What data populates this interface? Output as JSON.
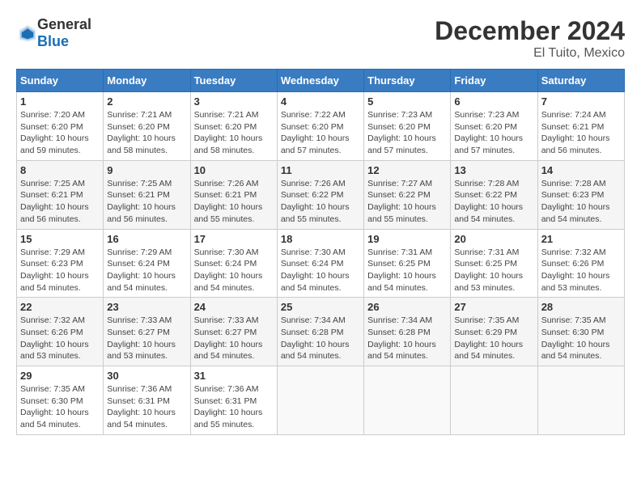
{
  "logo": {
    "general": "General",
    "blue": "Blue"
  },
  "header": {
    "title": "December 2024",
    "subtitle": "El Tuito, Mexico"
  },
  "calendar": {
    "columns": [
      "Sunday",
      "Monday",
      "Tuesday",
      "Wednesday",
      "Thursday",
      "Friday",
      "Saturday"
    ],
    "weeks": [
      [
        {
          "day": "",
          "info": ""
        },
        {
          "day": "",
          "info": ""
        },
        {
          "day": "",
          "info": ""
        },
        {
          "day": "",
          "info": ""
        },
        {
          "day": "5",
          "info": "Sunrise: 7:23 AM\nSunset: 6:20 PM\nDaylight: 10 hours\nand 57 minutes."
        },
        {
          "day": "6",
          "info": "Sunrise: 7:23 AM\nSunset: 6:20 PM\nDaylight: 10 hours\nand 57 minutes."
        },
        {
          "day": "7",
          "info": "Sunrise: 7:24 AM\nSunset: 6:21 PM\nDaylight: 10 hours\nand 56 minutes."
        }
      ],
      [
        {
          "day": "1",
          "info": "Sunrise: 7:20 AM\nSunset: 6:20 PM\nDaylight: 10 hours\nand 59 minutes."
        },
        {
          "day": "2",
          "info": "Sunrise: 7:21 AM\nSunset: 6:20 PM\nDaylight: 10 hours\nand 58 minutes."
        },
        {
          "day": "3",
          "info": "Sunrise: 7:21 AM\nSunset: 6:20 PM\nDaylight: 10 hours\nand 58 minutes."
        },
        {
          "day": "4",
          "info": "Sunrise: 7:22 AM\nSunset: 6:20 PM\nDaylight: 10 hours\nand 57 minutes."
        },
        {
          "day": "5",
          "info": "Sunrise: 7:23 AM\nSunset: 6:20 PM\nDaylight: 10 hours\nand 57 minutes."
        },
        {
          "day": "6",
          "info": "Sunrise: 7:23 AM\nSunset: 6:20 PM\nDaylight: 10 hours\nand 57 minutes."
        },
        {
          "day": "7",
          "info": "Sunrise: 7:24 AM\nSunset: 6:21 PM\nDaylight: 10 hours\nand 56 minutes."
        }
      ],
      [
        {
          "day": "8",
          "info": "Sunrise: 7:25 AM\nSunset: 6:21 PM\nDaylight: 10 hours\nand 56 minutes."
        },
        {
          "day": "9",
          "info": "Sunrise: 7:25 AM\nSunset: 6:21 PM\nDaylight: 10 hours\nand 56 minutes."
        },
        {
          "day": "10",
          "info": "Sunrise: 7:26 AM\nSunset: 6:21 PM\nDaylight: 10 hours\nand 55 minutes."
        },
        {
          "day": "11",
          "info": "Sunrise: 7:26 AM\nSunset: 6:22 PM\nDaylight: 10 hours\nand 55 minutes."
        },
        {
          "day": "12",
          "info": "Sunrise: 7:27 AM\nSunset: 6:22 PM\nDaylight: 10 hours\nand 55 minutes."
        },
        {
          "day": "13",
          "info": "Sunrise: 7:28 AM\nSunset: 6:22 PM\nDaylight: 10 hours\nand 54 minutes."
        },
        {
          "day": "14",
          "info": "Sunrise: 7:28 AM\nSunset: 6:23 PM\nDaylight: 10 hours\nand 54 minutes."
        }
      ],
      [
        {
          "day": "15",
          "info": "Sunrise: 7:29 AM\nSunset: 6:23 PM\nDaylight: 10 hours\nand 54 minutes."
        },
        {
          "day": "16",
          "info": "Sunrise: 7:29 AM\nSunset: 6:24 PM\nDaylight: 10 hours\nand 54 minutes."
        },
        {
          "day": "17",
          "info": "Sunrise: 7:30 AM\nSunset: 6:24 PM\nDaylight: 10 hours\nand 54 minutes."
        },
        {
          "day": "18",
          "info": "Sunrise: 7:30 AM\nSunset: 6:24 PM\nDaylight: 10 hours\nand 54 minutes."
        },
        {
          "day": "19",
          "info": "Sunrise: 7:31 AM\nSunset: 6:25 PM\nDaylight: 10 hours\nand 54 minutes."
        },
        {
          "day": "20",
          "info": "Sunrise: 7:31 AM\nSunset: 6:25 PM\nDaylight: 10 hours\nand 53 minutes."
        },
        {
          "day": "21",
          "info": "Sunrise: 7:32 AM\nSunset: 6:26 PM\nDaylight: 10 hours\nand 53 minutes."
        }
      ],
      [
        {
          "day": "22",
          "info": "Sunrise: 7:32 AM\nSunset: 6:26 PM\nDaylight: 10 hours\nand 53 minutes."
        },
        {
          "day": "23",
          "info": "Sunrise: 7:33 AM\nSunset: 6:27 PM\nDaylight: 10 hours\nand 53 minutes."
        },
        {
          "day": "24",
          "info": "Sunrise: 7:33 AM\nSunset: 6:27 PM\nDaylight: 10 hours\nand 54 minutes."
        },
        {
          "day": "25",
          "info": "Sunrise: 7:34 AM\nSunset: 6:28 PM\nDaylight: 10 hours\nand 54 minutes."
        },
        {
          "day": "26",
          "info": "Sunrise: 7:34 AM\nSunset: 6:28 PM\nDaylight: 10 hours\nand 54 minutes."
        },
        {
          "day": "27",
          "info": "Sunrise: 7:35 AM\nSunset: 6:29 PM\nDaylight: 10 hours\nand 54 minutes."
        },
        {
          "day": "28",
          "info": "Sunrise: 7:35 AM\nSunset: 6:30 PM\nDaylight: 10 hours\nand 54 minutes."
        }
      ],
      [
        {
          "day": "29",
          "info": "Sunrise: 7:35 AM\nSunset: 6:30 PM\nDaylight: 10 hours\nand 54 minutes."
        },
        {
          "day": "30",
          "info": "Sunrise: 7:36 AM\nSunset: 6:31 PM\nDaylight: 10 hours\nand 54 minutes."
        },
        {
          "day": "31",
          "info": "Sunrise: 7:36 AM\nSunset: 6:31 PM\nDaylight: 10 hours\nand 55 minutes."
        },
        {
          "day": "",
          "info": ""
        },
        {
          "day": "",
          "info": ""
        },
        {
          "day": "",
          "info": ""
        },
        {
          "day": "",
          "info": ""
        }
      ]
    ]
  }
}
